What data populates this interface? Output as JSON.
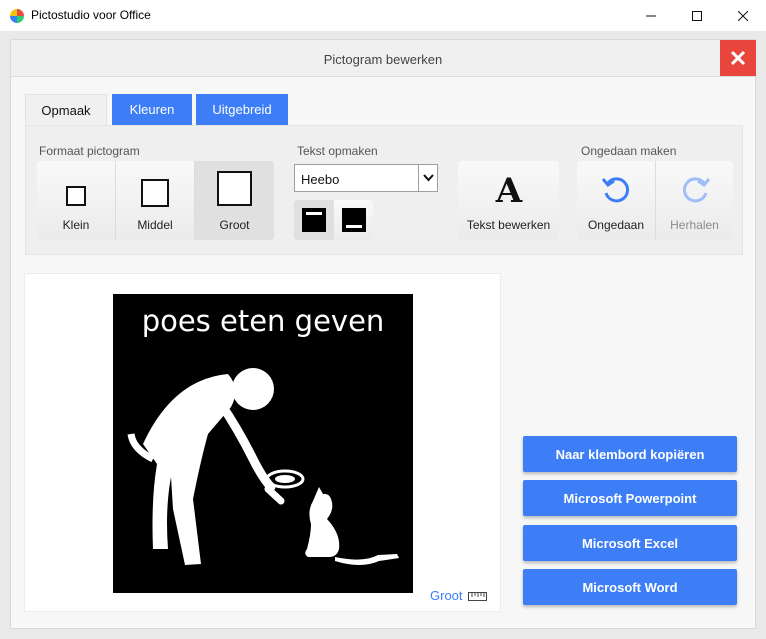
{
  "window": {
    "title": "Pictostudio voor Office"
  },
  "dialog": {
    "title": "Pictogram bewerken"
  },
  "tabs": [
    {
      "label": "Opmaak"
    },
    {
      "label": "Kleuren"
    },
    {
      "label": "Uitgebreid"
    }
  ],
  "format": {
    "label": "Formaat pictogram",
    "options": [
      {
        "label": "Klein"
      },
      {
        "label": "Middel"
      },
      {
        "label": "Groot"
      }
    ],
    "selected": "Groot"
  },
  "text_format": {
    "label": "Tekst opmaken",
    "font_value": "Heebo",
    "edit_label": "Tekst bewerken"
  },
  "undo": {
    "label": "Ongedaan maken",
    "undo_label": "Ongedaan",
    "redo_label": "Herhalen"
  },
  "preview": {
    "caption": "poes eten geven",
    "size_label": "Groot"
  },
  "actions": [
    {
      "label": "Naar klembord kopiëren"
    },
    {
      "label": "Microsoft Powerpoint"
    },
    {
      "label": "Microsoft Excel"
    },
    {
      "label": "Microsoft Word"
    }
  ],
  "colors": {
    "accent": "#3d7ef7",
    "close": "#e8453c"
  }
}
